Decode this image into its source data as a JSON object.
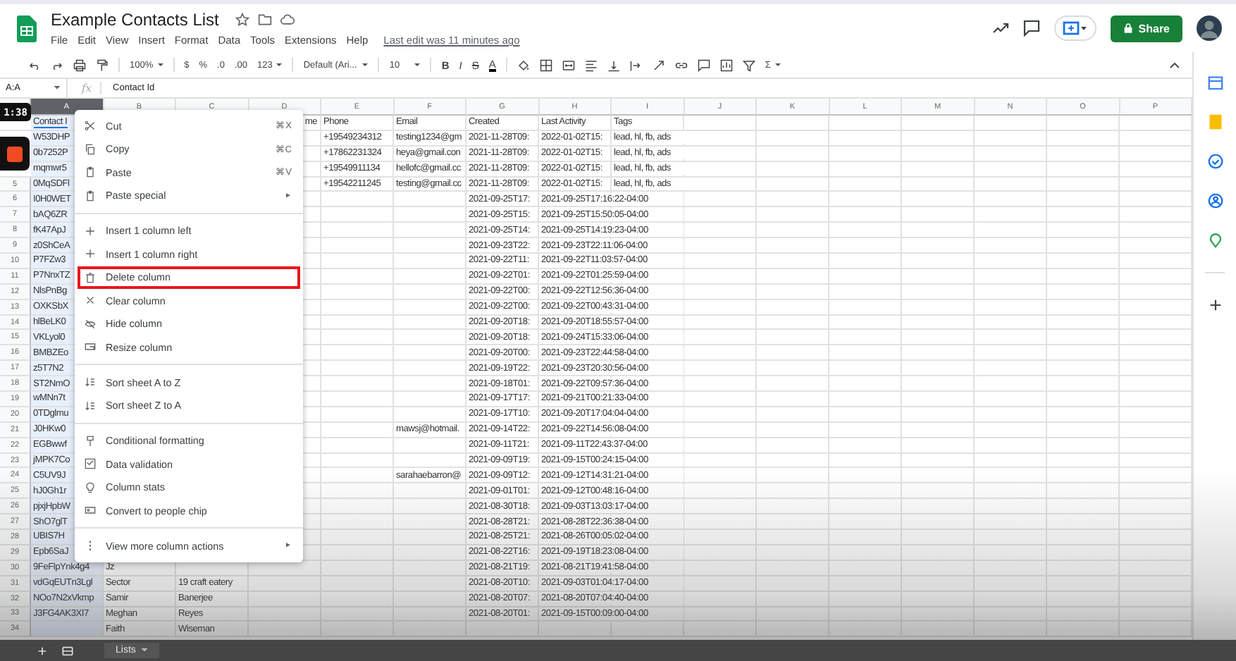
{
  "app": {
    "title": "Example Contacts List",
    "menu": [
      "File",
      "Edit",
      "View",
      "Insert",
      "Format",
      "Data",
      "Tools",
      "Extensions",
      "Help"
    ],
    "last_edit": "Last edit was 11 minutes ago",
    "share": "Share"
  },
  "toolbar": {
    "zoom": "100%",
    "currency": "$",
    "percent": "%",
    "decrease_decimals": ".0",
    "increase_decimals": ".00",
    "number_format": "123",
    "font": "Default (Ari...",
    "font_size": "10",
    "bold": "B",
    "italic": "I",
    "strikethrough": "S",
    "text_color": "A",
    "functions": "Σ"
  },
  "formula_bar": {
    "name_box": "A:A",
    "fx": "fx",
    "value": "Contact Id"
  },
  "columns": [
    {
      "label": "A",
      "selected": true
    },
    {
      "label": "B",
      "selected": false
    },
    {
      "label": "C",
      "selected": false
    },
    {
      "label": "D",
      "selected": false
    },
    {
      "label": "E",
      "selected": false
    },
    {
      "label": "F",
      "selected": false
    },
    {
      "label": "G",
      "selected": false
    },
    {
      "label": "H",
      "selected": false
    },
    {
      "label": "I",
      "selected": false
    },
    {
      "label": "J",
      "selected": false
    },
    {
      "label": "K",
      "selected": false
    },
    {
      "label": "L",
      "selected": false
    },
    {
      "label": "M",
      "selected": false
    },
    {
      "label": "N",
      "selected": false
    },
    {
      "label": "O",
      "selected": false
    },
    {
      "label": "P",
      "selected": false
    }
  ],
  "rows": [
    {
      "a": "Contact I",
      "d": "me",
      "e": "Phone",
      "f": "Email",
      "g": "Created",
      "h": "Last Activity",
      "i": "Tags"
    },
    {
      "a": "W53DHP",
      "e": "+19549234312",
      "f": "testing1234@gm",
      "g": "2021-11-28T09:",
      "h": "2022-01-02T15:",
      "i": "lead, hl, fb, ads"
    },
    {
      "a": "0b7252P",
      "e": "+17862231324",
      "f": "heya@gmail.con",
      "g": "2021-11-28T09:",
      "h": "2022-01-02T15:",
      "i": "lead, hl, fb, ads"
    },
    {
      "a": "mqmwr5",
      "e": "+19549911134",
      "f": "hellofc@gmail.cc",
      "g": "2021-11-28T09:",
      "h": "2022-01-02T15:",
      "i": "lead, hl, fb, ads"
    },
    {
      "row": "5",
      "a": "0MqSDFl",
      "e": "+19542211245",
      "f": "testing@gmail.cc",
      "g": "2021-11-28T09:",
      "h": "2022-01-02T15:",
      "i": "lead, hl, fb, ads"
    },
    {
      "row": "6",
      "a": "I0H0WET",
      "g": "2021-09-25T17:",
      "h": "2021-09-25T17:16:22-04:00"
    },
    {
      "row": "7",
      "a": "bAQ6ZR",
      "g": "2021-09-25T15:",
      "h": "2021-09-25T15:50:05-04:00"
    },
    {
      "row": "8",
      "a": "fK47ApJ",
      "g": "2021-09-25T14:",
      "h": "2021-09-25T14:19:23-04:00"
    },
    {
      "row": "9",
      "a": "z0ShCeA",
      "g": "2021-09-23T22:",
      "h": "2021-09-23T22:11:06-04:00"
    },
    {
      "row": "10",
      "a": "P7FZw3",
      "g": "2021-09-22T11:",
      "h": "2021-09-22T11:03:57-04:00"
    },
    {
      "row": "11",
      "a": "P7NnxTZ",
      "g": "2021-09-22T01:",
      "h": "2021-09-22T01:25:59-04:00"
    },
    {
      "row": "12",
      "a": "NlsPnBg",
      "g": "2021-09-22T00:",
      "h": "2021-09-22T12:56:36-04:00"
    },
    {
      "row": "13",
      "a": "OXKSbX",
      "g": "2021-09-22T00:",
      "h": "2021-09-22T00:43:31-04:00"
    },
    {
      "row": "14",
      "a": "hlBeLK0",
      "g": "2021-09-20T18:",
      "h": "2021-09-20T18:55:57-04:00"
    },
    {
      "row": "15",
      "a": "VKLyol0",
      "g": "2021-09-20T18:",
      "h": "2021-09-24T15:33:06-04:00"
    },
    {
      "row": "16",
      "a": "BMBZEo",
      "g": "2021-09-20T00:",
      "h": "2021-09-23T22:44:58-04:00"
    },
    {
      "row": "17",
      "a": "z5T7N2",
      "g": "2021-09-19T22:",
      "h": "2021-09-23T20:30:56-04:00"
    },
    {
      "row": "18",
      "a": "ST2NmO",
      "g": "2021-09-18T01:",
      "h": "2021-09-22T09:57:36-04:00"
    },
    {
      "row": "19",
      "a": "wMNn7t",
      "g": "2021-09-17T17:",
      "h": "2021-09-21T00:21:33-04:00"
    },
    {
      "row": "20",
      "a": "0TDglmu",
      "g": "2021-09-17T10:",
      "h": "2021-09-20T17:04:04-04:00"
    },
    {
      "row": "21",
      "a": "J0HKw0",
      "f": "mawsj@hotmail.",
      "g": "2021-09-14T22:",
      "h": "2021-09-22T14:56:08-04:00"
    },
    {
      "row": "22",
      "a": "EGBwwf",
      "g": "2021-09-11T21:",
      "h": "2021-09-11T22:43:37-04:00"
    },
    {
      "row": "23",
      "a": "jMPK7Co",
      "g": "2021-09-09T19:",
      "h": "2021-09-15T00:24:15-04:00"
    },
    {
      "row": "24",
      "a": "C5UV9J",
      "f": "sarahaebarron@",
      "g": "2021-09-09T12:",
      "h": "2021-09-12T14:31:21-04:00"
    },
    {
      "row": "25",
      "a": "hJ0Gh1r",
      "g": "2021-09-01T01:",
      "h": "2021-09-12T00:48:16-04:00"
    },
    {
      "row": "26",
      "a": "pjxjHpbW",
      "g": "2021-08-30T18:",
      "h": "2021-09-03T13:03:17-04:00"
    },
    {
      "row": "27",
      "a": "ShO7glT",
      "g": "2021-08-28T21:",
      "h": "2021-08-28T22:36:38-04:00"
    },
    {
      "row": "28",
      "a": "UBIS7H",
      "g": "2021-08-25T21:",
      "h": "2021-08-26T00:05:02-04:00"
    },
    {
      "row": "29",
      "a": "Epb6SaJ",
      "g": "2021-08-22T16:",
      "h": "2021-09-19T18:23:08-04:00"
    },
    {
      "row": "30",
      "a": "9FeFlpYnk4g4",
      "b": "Jz",
      "g": "2021-08-21T19:",
      "h": "2021-08-21T19:41:58-04:00"
    },
    {
      "row": "31",
      "a": "vdGqEUTn3Lgl",
      "b": "Sector",
      "c": "19 craft eatery",
      "g": "2021-08-20T10:",
      "h": "2021-09-03T01:04:17-04:00"
    },
    {
      "row": "32",
      "a": "NOo7N2xVkmp",
      "b": "Samir",
      "c": "Banerjee",
      "g": "2021-08-20T07:",
      "h": "2021-08-20T07:04:40-04:00"
    },
    {
      "row": "33",
      "a": "J3FG4AK3XI7",
      "b": "Meghan",
      "c": "Reyes",
      "g": "2021-08-20T01:",
      "h": "2021-09-15T00:09:00-04:00"
    },
    {
      "row": "34",
      "b": "Faith",
      "c": "Wiseman"
    }
  ],
  "context_menu": [
    {
      "kind": "command",
      "label": "Cut",
      "shortcut": "⌘X",
      "highlighted": false
    },
    {
      "kind": "command",
      "label": "Copy",
      "shortcut": "⌘C",
      "highlighted": false
    },
    {
      "kind": "command",
      "label": "Paste",
      "shortcut": "⌘V",
      "highlighted": false
    },
    {
      "kind": "command",
      "label": "Paste special",
      "submenu": "►",
      "highlighted": false
    },
    {
      "kind": "divider"
    },
    {
      "kind": "command",
      "label": "Insert 1 column left",
      "highlighted": false
    },
    {
      "kind": "command",
      "label": "Insert 1 column right",
      "highlighted": false
    },
    {
      "kind": "command",
      "label": "Delete column",
      "highlighted": true
    },
    {
      "kind": "command",
      "label": "Clear column",
      "highlighted": false
    },
    {
      "kind": "command",
      "label": "Hide column",
      "highlighted": false
    },
    {
      "kind": "command",
      "label": "Resize column",
      "highlighted": false
    },
    {
      "kind": "divider"
    },
    {
      "kind": "command",
      "label": "Sort sheet A to Z",
      "highlighted": false
    },
    {
      "kind": "command",
      "label": "Sort sheet Z to A",
      "highlighted": false
    },
    {
      "kind": "divider"
    },
    {
      "kind": "command",
      "label": "Conditional formatting",
      "highlighted": false
    },
    {
      "kind": "command",
      "label": "Data validation",
      "highlighted": false
    },
    {
      "kind": "command",
      "label": "Column stats",
      "highlighted": false
    },
    {
      "kind": "command",
      "label": "Convert to people chip",
      "highlighted": false
    },
    {
      "kind": "divider"
    },
    {
      "kind": "command",
      "label": "View more column actions",
      "submenu": "►",
      "highlighted": false
    }
  ],
  "overlay": {
    "timer": "1:38"
  },
  "sheet_tabs": [
    {
      "label": "Lists",
      "selected": true
    }
  ]
}
